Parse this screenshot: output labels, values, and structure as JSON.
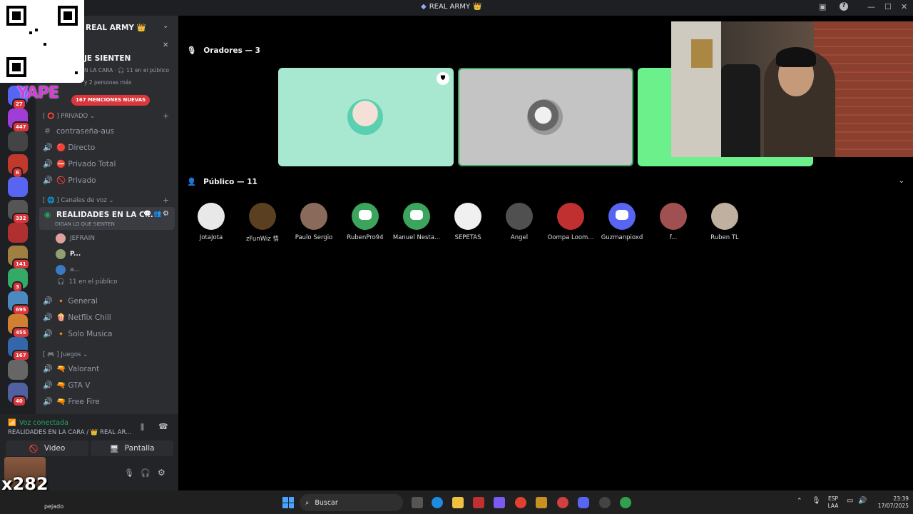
{
  "window": {
    "title": "REAL ARMY",
    "title_emoji": "👑"
  },
  "qr_overlay": {
    "brand": "YAPE"
  },
  "guilds": [
    {
      "badge": "27",
      "color": "#5865f2"
    },
    {
      "badge": "447",
      "color": "#a03dd6"
    },
    {
      "badge": "",
      "color": "#444"
    },
    {
      "badge": "6",
      "color": "#c0392b"
    },
    {
      "badge": "",
      "color": "#5865f2"
    },
    {
      "badge": "332",
      "color": "#555"
    },
    {
      "badge": "",
      "color": "#b03030"
    },
    {
      "badge": "141",
      "color": "#a08040"
    },
    {
      "badge": "3",
      "color": "#3a6"
    },
    {
      "badge": "695",
      "color": "#4a8ac0"
    },
    {
      "badge": "455",
      "color": "#d08030"
    },
    {
      "badge": "167",
      "color": "#3366aa"
    },
    {
      "badge": "",
      "color": "#666"
    },
    {
      "badge": "40",
      "color": "#5060a0"
    }
  ],
  "sidebar": {
    "server_name": "REAL ARMY",
    "server_emoji": "👑",
    "event_title": "JE SIENTEN",
    "event_sub": "N LA CARA · 🎧 11 en el público",
    "event_sub2": "y 2 personas más",
    "mentions": "167 MENCIONES NUEVAS",
    "cat_privado": "[ ⭕ ] PRIVADO ⌄",
    "channels_private": [
      {
        "name": "contraseña-aus",
        "icon": "#"
      },
      {
        "name": "🔴 Directo",
        "icon": "🔊"
      },
      {
        "name": "⛔ Privado Total",
        "icon": "🔊"
      },
      {
        "name": "🚫 Privado",
        "icon": "🔊"
      }
    ],
    "cat_voice": "[ 🌐 ] Canales de voz ⌄",
    "active_channel": "REALIDADES EN LA C...",
    "active_sub": "DIGAN LO QUE SIENTEN",
    "members": [
      {
        "name": "JEFRAIN"
      },
      {
        "name": "P..."
      },
      {
        "name": "a..."
      }
    ],
    "public_count": "11 en el público",
    "channels_voice": [
      {
        "name": "🔸 General"
      },
      {
        "name": "🍿 Netflix Chill"
      },
      {
        "name": "🔸 Solo Musica"
      }
    ],
    "cat_games": "[ 🎮 ] Juegos ⌄",
    "channels_games": [
      {
        "name": "🔫 Valorant"
      },
      {
        "name": "🔫 GTA V"
      },
      {
        "name": "🔫 Free Fire"
      }
    ]
  },
  "voice_panel": {
    "status": "Voz conectada",
    "location": "REALIDADES EN LA CARA / 👑 REAL AR...",
    "video_label": "Video",
    "screen_label": "Pantalla",
    "overlay_counter": "x282"
  },
  "stage": {
    "speakers_label": "Oradores — 3",
    "public_label": "Público — 11",
    "audience": [
      {
        "name": "JotaJota",
        "color": "#e8e8e8"
      },
      {
        "name": "zFunWiz 悟",
        "color": "#5a4020"
      },
      {
        "name": "Paulo Sergio",
        "color": "#8a6a5a"
      },
      {
        "name": "RubenPro94",
        "color": "#3ba55d"
      },
      {
        "name": "Manuel Nesta...",
        "color": "#3ba55d"
      },
      {
        "name": "SEPETAS",
        "color": "#f0f0f0"
      },
      {
        "name": "Angel",
        "color": "#505050"
      },
      {
        "name": "Oompa Loom...",
        "color": "#c03030"
      },
      {
        "name": "Guzmanpioxd",
        "color": "#5865f2"
      },
      {
        "name": "f...",
        "color": "#a05050"
      },
      {
        "name": "Ruben TL",
        "color": "#c0b0a0"
      }
    ]
  },
  "taskbar": {
    "weather": "pejado",
    "search_placeholder": "Buscar",
    "lang1": "ESP",
    "lang2": "LAA",
    "time": "23:39",
    "date": "17/07/2025"
  }
}
